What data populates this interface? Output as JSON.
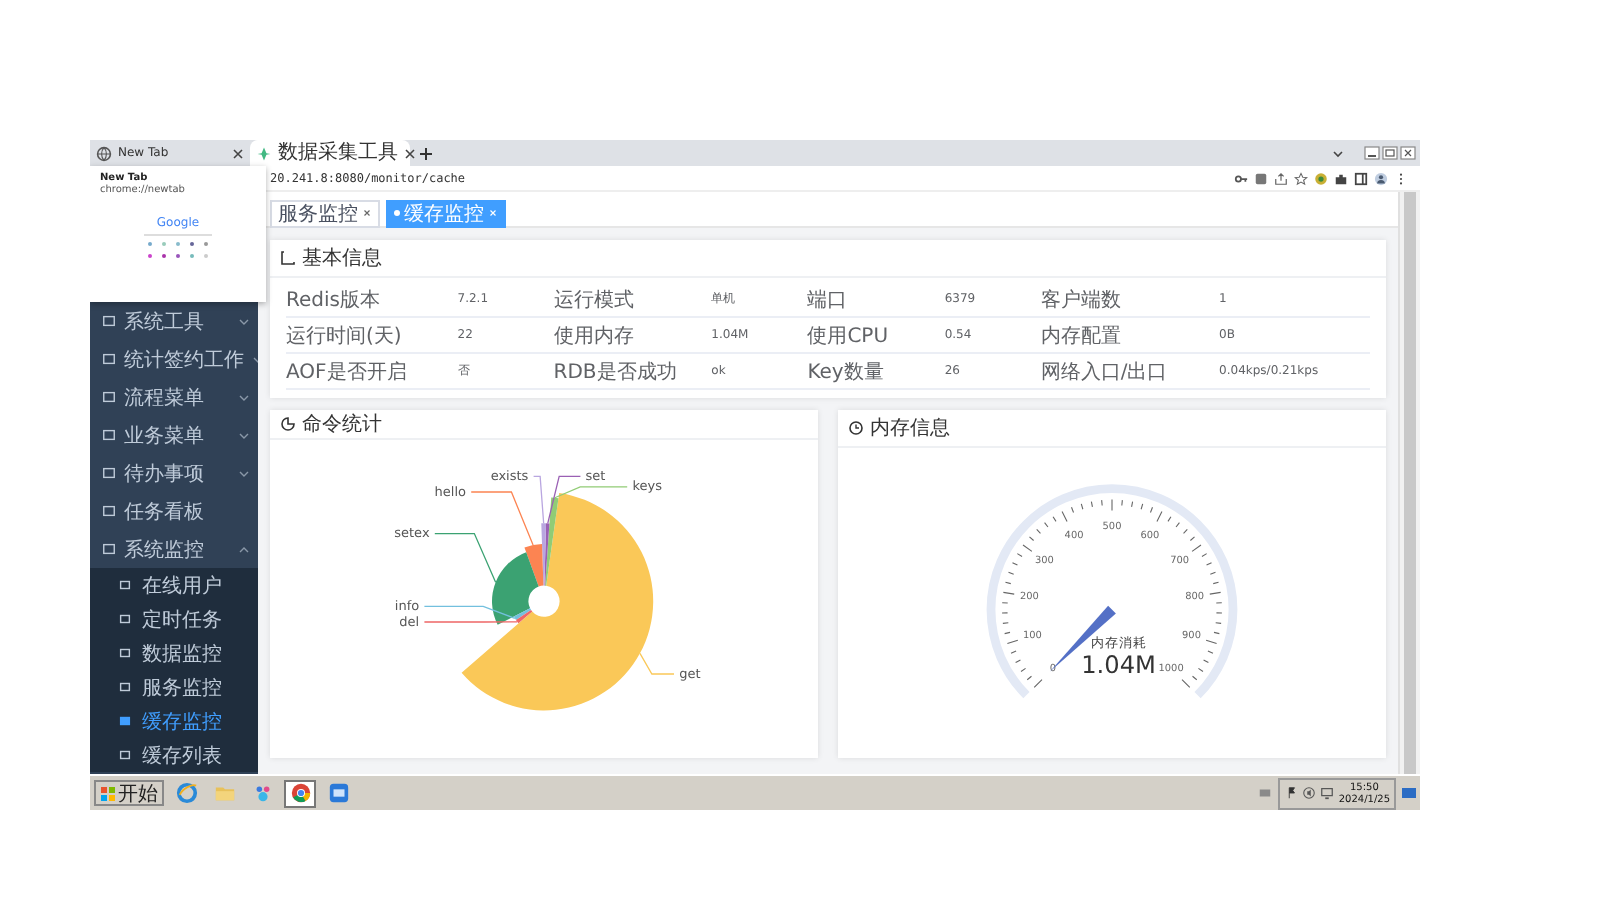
{
  "browser": {
    "tabs": [
      {
        "title": "New Tab",
        "selected": false
      },
      {
        "title": "数据采集工具",
        "selected": true
      }
    ],
    "url": "20.241.8:8080/monitor/cache"
  },
  "tab_preview": {
    "title": "New Tab",
    "url": "chrome://newtab",
    "logo": "Google"
  },
  "sidebar": {
    "items": [
      {
        "label": "系统工具",
        "kind": "group",
        "expanded": false
      },
      {
        "label": "统计签约工作",
        "kind": "group",
        "expanded": false
      },
      {
        "label": "流程菜单",
        "kind": "group",
        "expanded": false
      },
      {
        "label": "业务菜单",
        "kind": "group",
        "expanded": false
      },
      {
        "label": "待办事项",
        "kind": "group",
        "expanded": false
      },
      {
        "label": "任务看板",
        "kind": "link"
      },
      {
        "label": "系统监控",
        "kind": "group",
        "expanded": true,
        "children": [
          {
            "label": "在线用户",
            "selected": false
          },
          {
            "label": "定时任务",
            "selected": false
          },
          {
            "label": "数据监控",
            "selected": false
          },
          {
            "label": "服务监控",
            "selected": false
          },
          {
            "label": "缓存监控",
            "selected": true
          },
          {
            "label": "缓存列表",
            "selected": false
          }
        ]
      }
    ]
  },
  "tags": [
    {
      "label": "服务监控",
      "selected": false
    },
    {
      "label": "缓存监控",
      "selected": true
    }
  ],
  "basic_info": {
    "title": "基本信息",
    "rows": [
      [
        {
          "label": "Redis版本",
          "value": "7.2.1"
        },
        {
          "label": "运行模式",
          "value": "单机"
        },
        {
          "label": "端口",
          "value": "6379"
        },
        {
          "label": "客户端数",
          "value": "1"
        }
      ],
      [
        {
          "label": "运行时间(天)",
          "value": "22"
        },
        {
          "label": "使用内存",
          "value": "1.04M"
        },
        {
          "label": "使用CPU",
          "value": "0.54"
        },
        {
          "label": "内存配置",
          "value": "0B"
        }
      ],
      [
        {
          "label": "AOF是否开启",
          "value": "否"
        },
        {
          "label": "RDB是否成功",
          "value": "ok"
        },
        {
          "label": "Key数量",
          "value": "26"
        },
        {
          "label": "网络入口/出口",
          "value": "0.04kps/0.21kps"
        }
      ]
    ]
  },
  "command_stats": {
    "title": "命令统计",
    "slices": [
      {
        "label": "get",
        "color": "#fac858"
      },
      {
        "label": "keys",
        "color": "#91cc75"
      },
      {
        "label": "set",
        "color": "#9a60b4"
      },
      {
        "label": "exists",
        "color": "#b9a6e0"
      },
      {
        "label": "hello",
        "color": "#fc8452"
      },
      {
        "label": "setex",
        "color": "#3ba272"
      },
      {
        "label": "info",
        "color": "#73c0de"
      },
      {
        "label": "del",
        "color": "#ee6666"
      }
    ]
  },
  "memory": {
    "title": "内存信息",
    "tick_labels": [
      "0",
      "100",
      "200",
      "300",
      "400",
      "500",
      "600",
      "700",
      "800",
      "900",
      "1000"
    ],
    "name": "内存消耗",
    "value": "1.04M"
  },
  "taskbar": {
    "start": "开始",
    "apps": [
      {
        "kind": "ie",
        "selected": false
      },
      {
        "kind": "folder",
        "selected": false
      },
      {
        "kind": "baidu",
        "selected": false
      },
      {
        "kind": "chrome",
        "selected": true
      },
      {
        "kind": "app",
        "selected": false
      }
    ],
    "time": "15:50",
    "date": "2024/1/25"
  }
}
